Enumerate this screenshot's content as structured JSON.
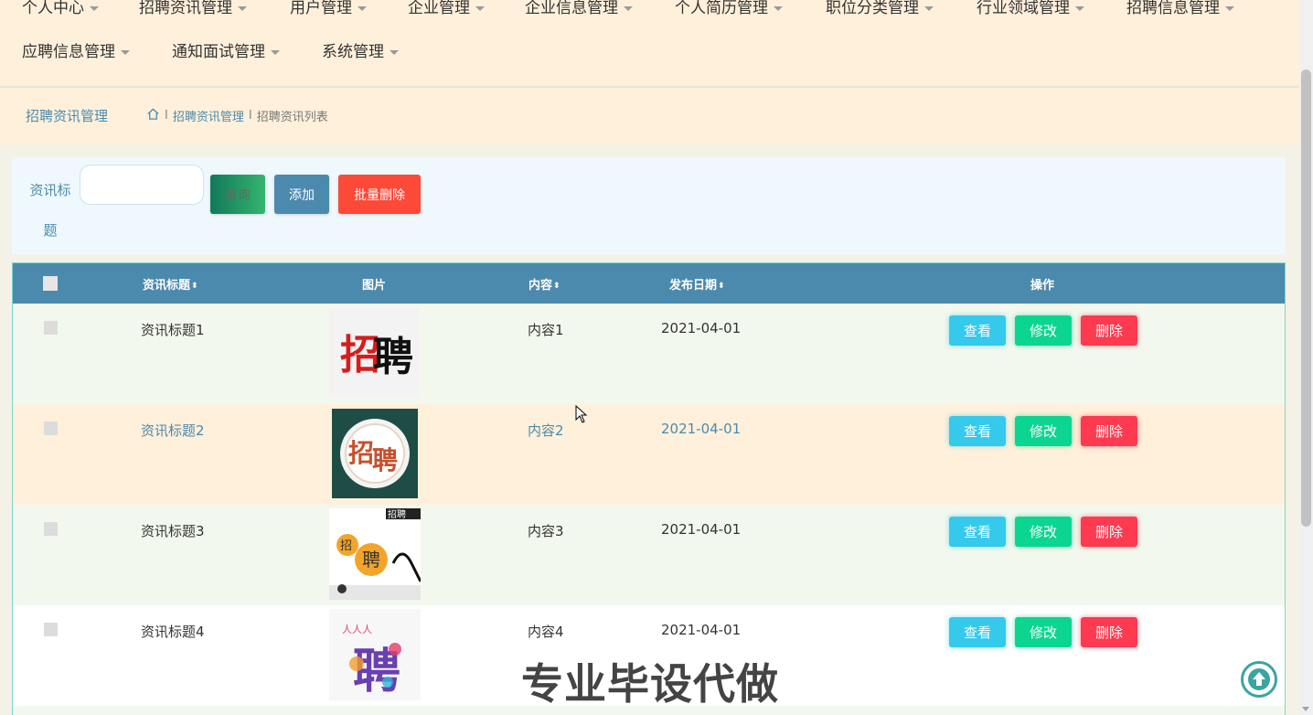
{
  "nav": {
    "items": [
      {
        "label": "个人中心"
      },
      {
        "label": "招聘资讯管理"
      },
      {
        "label": "用户管理"
      },
      {
        "label": "企业管理"
      },
      {
        "label": "企业信息管理"
      },
      {
        "label": "个人简历管理"
      },
      {
        "label": "职位分类管理"
      },
      {
        "label": "行业领域管理"
      },
      {
        "label": "招聘信息管理"
      },
      {
        "label": "应聘信息管理"
      },
      {
        "label": "通知面试管理"
      },
      {
        "label": "系统管理"
      }
    ]
  },
  "breadcrumb": {
    "title": "招聘资讯管理",
    "separator": "I",
    "items": [
      "招聘资讯管理",
      "招聘资讯列表"
    ],
    "icon": "home-icon"
  },
  "search": {
    "label": "资讯标题",
    "input_value": "",
    "query_button": "查询",
    "add_button": "添加",
    "batch_delete_button": "批量删除"
  },
  "table": {
    "columns": {
      "title": "资讯标题",
      "image": "图片",
      "content": "内容",
      "date": "发布日期",
      "actions": "操作"
    },
    "sort_icon": "sort-icon",
    "rows": [
      {
        "title": "资讯标题1",
        "content": "内容1",
        "date": "2021-04-01",
        "view": "查看",
        "edit": "修改",
        "delete": "删除"
      },
      {
        "title": "资讯标题2",
        "content": "内容2",
        "date": "2021-04-01",
        "view": "查看",
        "edit": "修改",
        "delete": "删除"
      },
      {
        "title": "资讯标题3",
        "content": "内容3",
        "date": "2021-04-01",
        "view": "查看",
        "edit": "修改",
        "delete": "删除"
      },
      {
        "title": "资讯标题4",
        "content": "内容4",
        "date": "2021-04-01",
        "view": "查看",
        "edit": "修改",
        "delete": "删除"
      }
    ]
  },
  "overlay": {
    "watermark": "专业毕设代做",
    "back_to_top_icon": "arrow-up-icon"
  },
  "colors": {
    "header_bg": "#fff0db",
    "table_header": "#4b8aad",
    "row_hover": "#fff0db",
    "row_odd": "#f2f8ee",
    "view_button": "#35c9ec",
    "edit_button": "#0cd591",
    "delete_button": "#fd3a50",
    "batch_delete": "#fd4938"
  }
}
